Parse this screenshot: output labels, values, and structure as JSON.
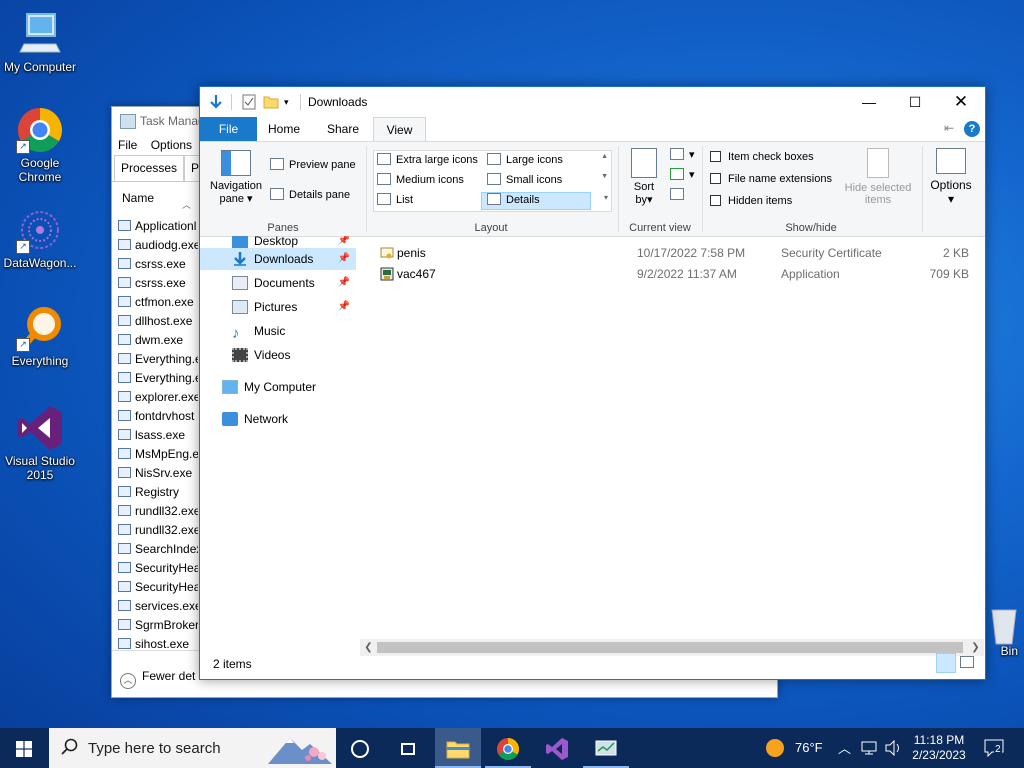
{
  "desktop": {
    "icons": [
      {
        "label": "My Computer"
      },
      {
        "label": "Google Chrome"
      },
      {
        "label": "DataWagon..."
      },
      {
        "label": "Everything"
      },
      {
        "label": "Visual Studio 2015"
      },
      {
        "label": "Bin"
      }
    ]
  },
  "task_manager": {
    "title": "Task Manag",
    "menu": [
      "File",
      "Options"
    ],
    "tabs": [
      "Processes",
      "Pe"
    ],
    "column_header": "Name",
    "processes": [
      "Applicationl",
      "audiodg.exe",
      "csrss.exe",
      "csrss.exe",
      "ctfmon.exe",
      "dllhost.exe",
      "dwm.exe",
      "Everything.e",
      "Everything.e",
      "explorer.exe",
      "fontdrvhost",
      "lsass.exe",
      "MsMpEng.e",
      "NisSrv.exe",
      "Registry",
      "rundll32.exe",
      "rundll32.exe",
      "SearchIndex",
      "SecurityHea",
      "SecurityHea",
      "services.exe",
      "SgrmBroker",
      "sihost.exe"
    ],
    "footer": "Fewer det"
  },
  "explorer": {
    "title": "Downloads",
    "ribbon_tabs": {
      "file": "File",
      "home": "Home",
      "share": "Share",
      "view": "View"
    },
    "panes": {
      "group_label": "Panes",
      "navigation_pane_line1": "Navigation",
      "navigation_pane_line2": "pane",
      "preview_pane": "Preview pane",
      "details_pane": "Details pane"
    },
    "layout": {
      "group_label": "Layout",
      "options": [
        "Extra large icons",
        "Large icons",
        "Medium icons",
        "Small icons",
        "List",
        "Details"
      ],
      "selected": "Details"
    },
    "current_view": {
      "group_label": "Current view",
      "sort_by_line1": "Sort",
      "sort_by_line2": "by"
    },
    "show_hide": {
      "group_label": "Show/hide",
      "item_check_boxes": "Item check boxes",
      "file_name_extensions": "File name extensions",
      "hidden_items": "Hidden items",
      "hide_selected_line1": "Hide selected",
      "hide_selected_line2": "items"
    },
    "options_label": "Options",
    "nav": {
      "desktop": "Desktop",
      "downloads": "Downloads",
      "documents": "Documents",
      "pictures": "Pictures",
      "music": "Music",
      "videos": "Videos",
      "my_computer": "My Computer",
      "network": "Network"
    },
    "files": [
      {
        "name": "penis",
        "date": "10/17/2022 7:58 PM",
        "type": "Security Certificate",
        "size": "2 KB"
      },
      {
        "name": "vac467",
        "date": "9/2/2022 11:37 AM",
        "type": "Application",
        "size": "709 KB"
      }
    ],
    "status": "2 items"
  },
  "taskbar": {
    "search_placeholder": "Type here to search",
    "weather": "76°F",
    "time": "11:18 PM",
    "date": "2/23/2023",
    "notification_count": "2"
  },
  "colors": {
    "accent": "#1979ca",
    "selection": "#cce8ff",
    "taskbar": "#0b2a5a"
  }
}
